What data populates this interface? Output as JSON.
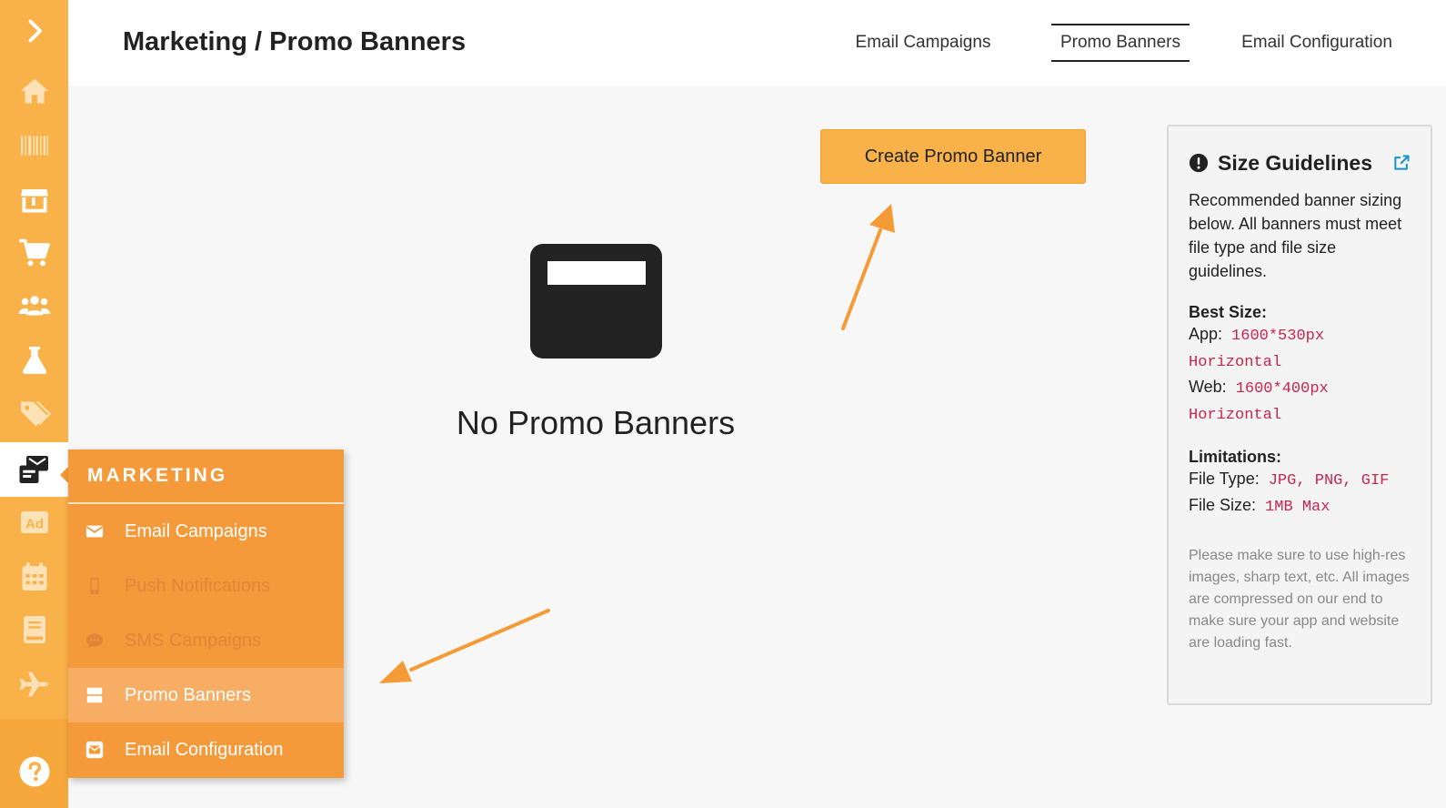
{
  "header": {
    "title": "Marketing / Promo Banners",
    "tabs": [
      {
        "label": "Email Campaigns"
      },
      {
        "label": "Promo Banners",
        "active": true
      },
      {
        "label": "Email Configuration"
      }
    ]
  },
  "sidebar": {
    "icons": [
      "expand-chevron-icon",
      "home-icon",
      "barcode-icon",
      "store-icon",
      "cart-icon",
      "users-icon",
      "flask-icon",
      "tags-icon",
      "marketing-icon",
      "ad-icon",
      "calendar-icon",
      "book-icon",
      "plane-icon",
      "help-icon"
    ],
    "active": "marketing-icon"
  },
  "main": {
    "create_button": "Create Promo Banner",
    "empty_text": "No Promo Banners"
  },
  "guidelines": {
    "title": "Size Guidelines",
    "description": "Recommended banner sizing below. All banners must meet file type and file size guidelines.",
    "best_size_label": "Best Size:",
    "app_label": "App:",
    "app_value": "1600*530px Horizontal",
    "web_label": "Web:",
    "web_value": "1600*400px Horizontal",
    "limitations_label": "Limitations:",
    "file_type_label": "File Type:",
    "file_type_value": "JPG, PNG, GIF",
    "file_size_label": "File Size:",
    "file_size_value": "1MB Max",
    "note": "Please make sure to use high-res images, sharp text, etc. All images are compressed on our end to make sure your app and website are loading fast."
  },
  "flyout": {
    "heading": "MARKETING",
    "items": [
      {
        "label": "Email Campaigns",
        "enabled": true
      },
      {
        "label": "Push Notifications",
        "enabled": false
      },
      {
        "label": "SMS Campaigns",
        "enabled": false
      },
      {
        "label": "Promo Banners",
        "enabled": true,
        "selected": true
      },
      {
        "label": "Email Configuration",
        "enabled": true
      }
    ]
  },
  "colors": {
    "sidebar": "#f9b24a",
    "flyout": "#f49a3a",
    "accent_button": "#f9b24a",
    "code_text": "#c7254e",
    "arrow": "#f59b35"
  }
}
